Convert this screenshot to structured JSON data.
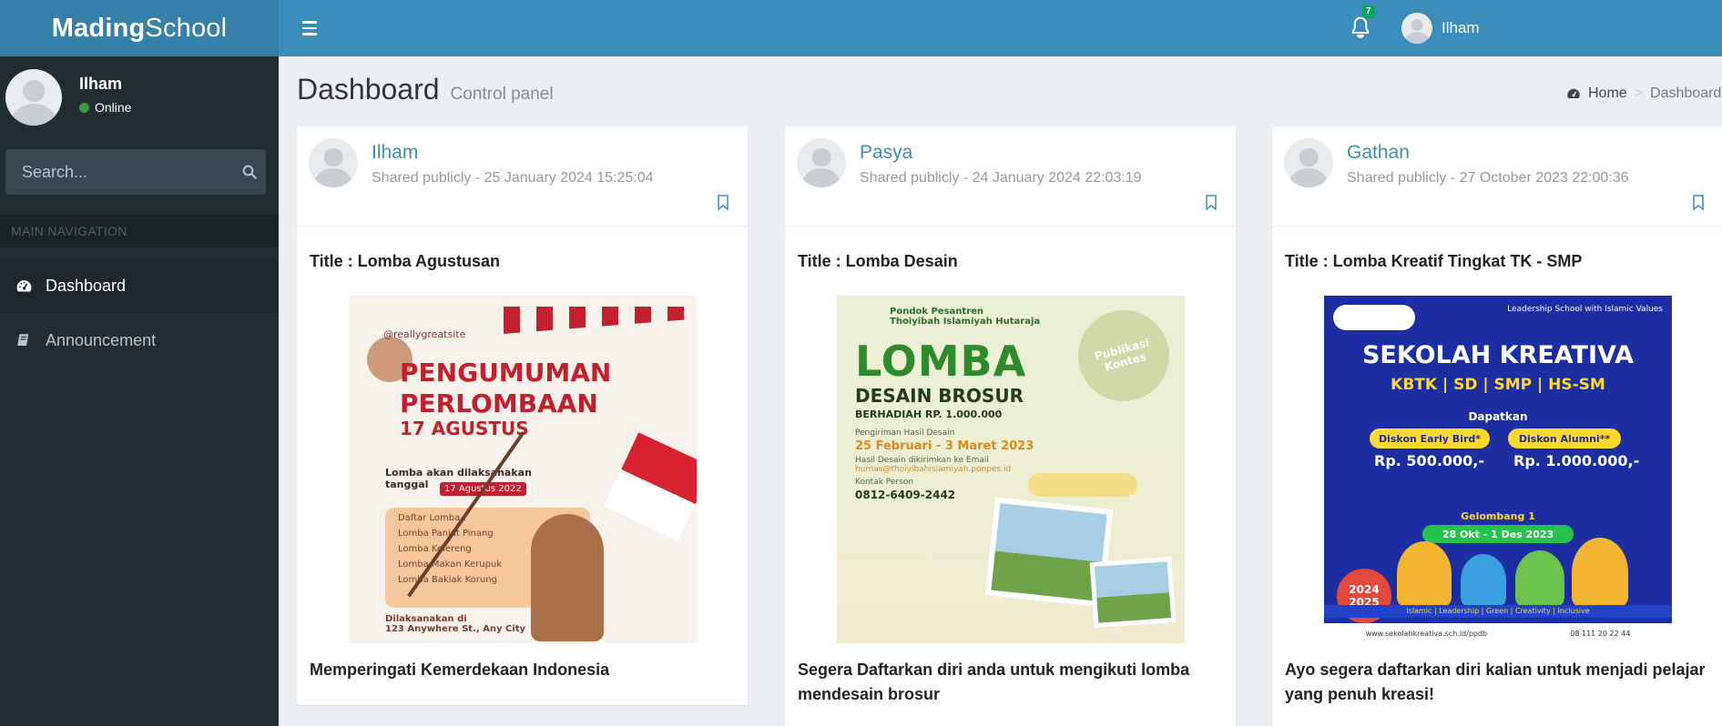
{
  "app": {
    "logo_bold": "Mading",
    "logo_light": "School"
  },
  "header": {
    "notification_count": "7",
    "user_name": "Ilham"
  },
  "sidebar": {
    "user_name": "Ilham",
    "status": "Online",
    "status_color": "#3c9a4b",
    "search_placeholder": "Search...",
    "nav_header": "MAIN NAVIGATION",
    "items": [
      {
        "label": "Dashboard",
        "icon": "dashboard-icon",
        "active": true
      },
      {
        "label": "Announcement",
        "icon": "book-icon",
        "active": false
      }
    ]
  },
  "page": {
    "title": "Dashboard",
    "subtitle": "Control panel",
    "breadcrumb": [
      "Home",
      "Dashboard"
    ]
  },
  "posts": [
    {
      "author": "Ilham",
      "meta": "Shared publicly - 25 January 2024 15:25:04",
      "title": "Title : Lomba Agustusan",
      "caption": "Memperingati Kemerdekaan Indonesia",
      "poster": {
        "site": "@reallygreatsite",
        "heading1": "PENGUMUMAN",
        "heading2": "PERLOMBAAN",
        "heading3": "17 AGUSTUS",
        "lead": "Lomba akan dilaksanakan",
        "lead2": "tanggal",
        "date_chip": "17 Agustus 2022",
        "list_title": "Daftar Lomba :",
        "list": [
          "Lomba Panjat Pinang",
          "Lomba Kelereng",
          "Lomba Makan Kerupuk",
          "Lomba Bakiak Korung"
        ],
        "footer1": "Dilaksanakan di",
        "footer2": "123 Anywhere St., Any City"
      }
    },
    {
      "author": "Pasya",
      "meta": "Shared publicly - 24 January 2024 22:03:19",
      "title": "Title : Lomba Desain",
      "caption": "Segera Daftarkan diri anda untuk mengikuti lomba mendesain brosur",
      "poster": {
        "org1": "Pondok Pesantren",
        "org2": "Thoiyibah Islamiyah Hutaraja",
        "badge": "Publikasi Kontes",
        "big": "LOMBA",
        "sub": "DESAIN BROSUR",
        "prize": "BERHADIAH RP. 1.000.000",
        "collect_label": "Pengiriman Hasil Desain",
        "dates": "25 Februari - 3 Maret 2023",
        "email_label": "Hasil Desain dikirimkan ke Email",
        "email": "humas@thoiyibahislamiyah.ponpes.id",
        "contact_label": "Kontak Person",
        "phone": "0812-6409-2442"
      }
    },
    {
      "author": "Gathan",
      "meta": "Shared publicly - 27 October 2023 22:00:36",
      "title": "Title : Lomba Kreatif Tingkat TK - SMP",
      "caption": "Ayo segera daftarkan diri kalian untuk menjadi pelajar yang penuh kreasi!",
      "poster": {
        "tag": "Leadership School with Islamic Values",
        "head": "SEKOLAH KREATIVA",
        "levels": "KBTK | SD | SMP | HS-SM",
        "dapatkan": "Dapatkan",
        "pill1": "Diskon Early Bird*",
        "pill2": "Diskon Alumni**",
        "price1": "Rp. 500.000,-",
        "price2": "Rp. 1.000.000,-",
        "gelombang": "Gelombang 1",
        "date": "28 Okt - 1 Des 2023",
        "year": "2024 2025",
        "values": "Islamic | Leadership | Green | Creativity | Inclusive",
        "website": "www.sekolahkreativa.sch.id/ppdb",
        "phone": "08 111 20 22 44"
      }
    }
  ],
  "colors": {
    "primary": "#3c8dbc",
    "logo_bg": "#367fa9",
    "sidebar_bg": "#222d32",
    "content_bg": "#ecf0f5"
  }
}
